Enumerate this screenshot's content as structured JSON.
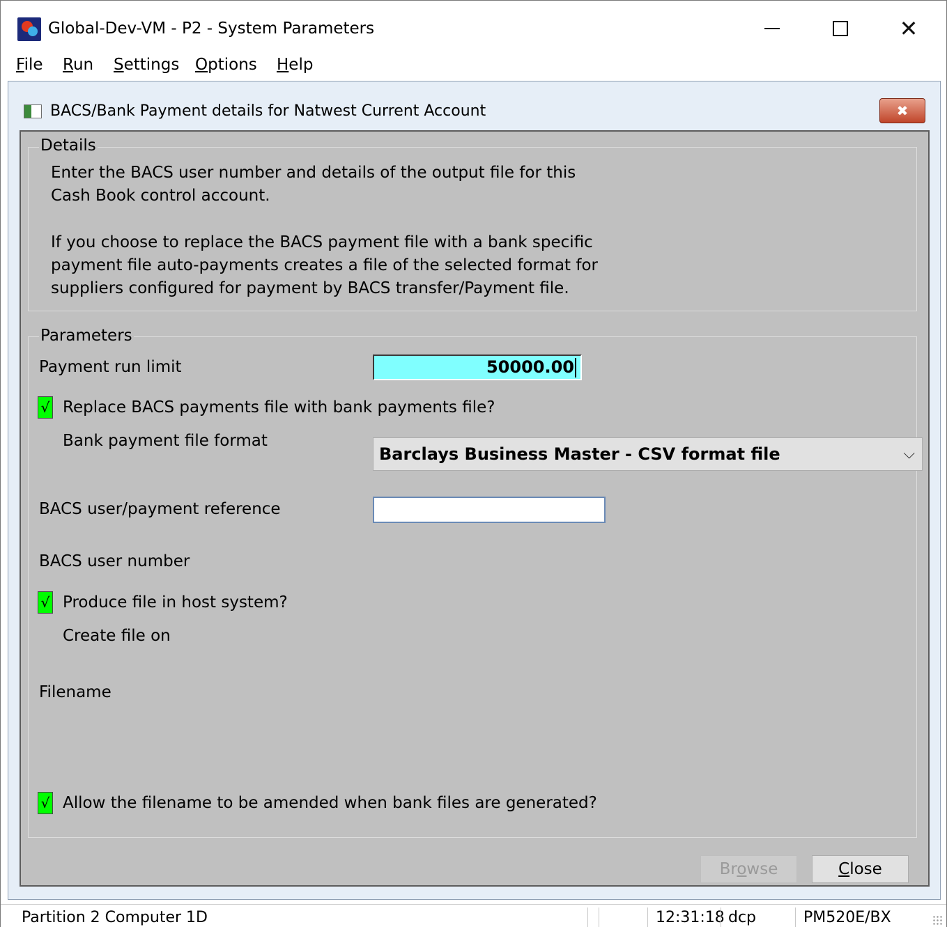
{
  "window": {
    "title": "Global-Dev-VM - P2 - System Parameters",
    "minimize_glyph": "",
    "close_glyph": "✕"
  },
  "menubar": {
    "items": [
      {
        "accel": "F",
        "rest": "ile"
      },
      {
        "accel": "R",
        "rest": "un"
      },
      {
        "accel": "S",
        "rest": "ettings"
      },
      {
        "accel": "O",
        "rest": "ptions"
      },
      {
        "accel": "H",
        "rest": "elp"
      }
    ]
  },
  "dialog": {
    "title": "BACS/Bank Payment details for Natwest Current Account",
    "close_glyph": "✖"
  },
  "details": {
    "label": "Details",
    "lines": [
      "Enter the BACS user number and details of the output file for this",
      "Cash Book control account.",
      "If you choose to replace the BACS payment file with a bank specific",
      "payment file auto-payments creates a file of the selected format for",
      "suppliers configured for payment by BACS transfer/Payment file."
    ]
  },
  "parameters": {
    "label": "Parameters",
    "payment_run_limit_label": "Payment run limit",
    "payment_run_limit_value": "50000.00",
    "replace_bacs_label": "Replace BACS payments file with bank payments file?",
    "replace_bacs_checked": true,
    "bank_format_label": "Bank payment file format",
    "bank_format_value": "Barclays Business Master - CSV format file",
    "bacs_reference_label": "BACS user/payment reference",
    "bacs_reference_value": "",
    "bacs_user_number_label": "BACS user number",
    "produce_file_label": "Produce file in host system?",
    "produce_file_checked": true,
    "create_file_on_label": "Create file on",
    "filename_label": "Filename",
    "allow_amend_label": "Allow the filename to be amended when bank files are generated?",
    "allow_amend_checked": true,
    "check_glyph": "√"
  },
  "buttons": {
    "browse": {
      "pre": "Br",
      "accel": "o",
      "post": "wse"
    },
    "close": {
      "pre": "",
      "accel": "C",
      "post": "lose"
    }
  },
  "statusbar": {
    "partition": "Partition 2 Computer 1D",
    "time": "12:31:18",
    "user": "dcp",
    "program": "PM520E/BX"
  }
}
